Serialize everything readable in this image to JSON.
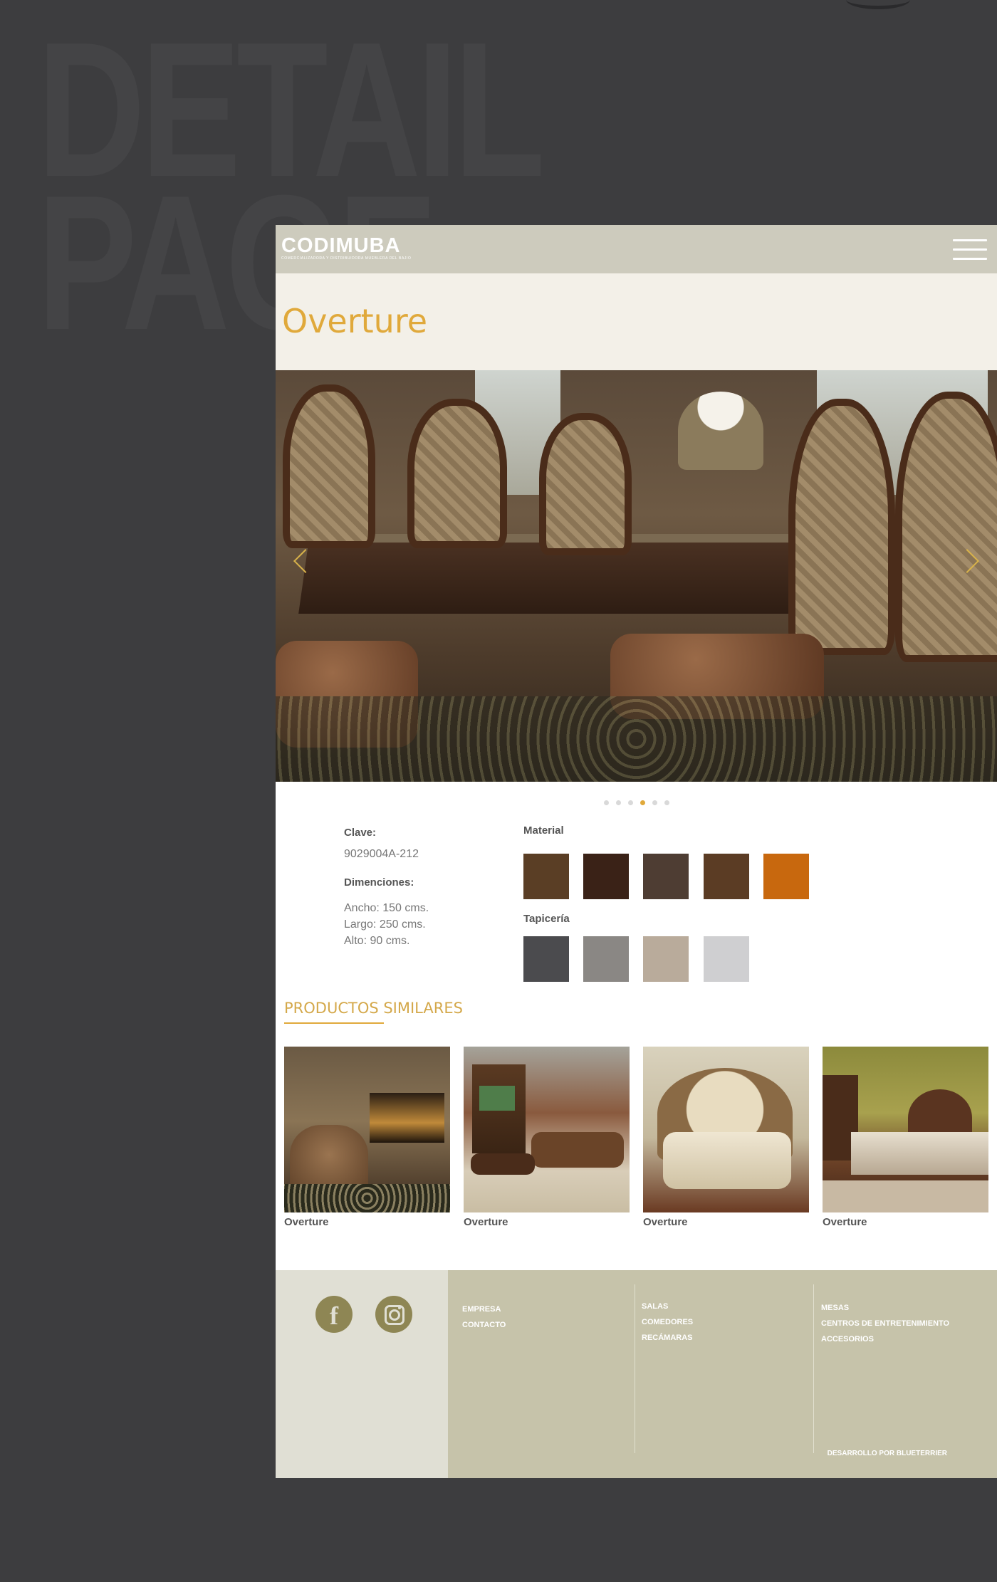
{
  "background": {
    "headline_line1": "DETAIL",
    "headline_line2": "PAGE"
  },
  "header": {
    "logo_text": "CODIMUBA",
    "logo_tagline": "COMERCIALIZADORA Y DISTRIBUIDORA MUEBLERA DEL BAJIO",
    "menu_icon": "hamburger-menu-icon"
  },
  "product": {
    "title": "Overture",
    "clave_label": "Clave:",
    "clave_value": "9029004A-212",
    "dimensions_label": "Dimenciones:",
    "dimensions": [
      "Ancho: 150 cms.",
      "Largo: 250 cms.",
      "Alto: 90 cms."
    ]
  },
  "carousel": {
    "prev_icon": "chevron-left-icon",
    "next_icon": "chevron-right-icon",
    "slide_count": 6,
    "active_index": 3
  },
  "options": {
    "material_label": "Material",
    "materials": [
      {
        "color": "#5a3e25"
      },
      {
        "color": "#3a2217"
      },
      {
        "color": "#4e3d33"
      },
      {
        "color": "#5b3c24"
      },
      {
        "color": "#c8680e"
      }
    ],
    "upholstery_label": "Tapicería",
    "upholstery": [
      {
        "color": "#4b4b4e"
      },
      {
        "color": "#8a8784"
      },
      {
        "color": "#b9ab9b"
      },
      {
        "color": "#cfcfd1"
      }
    ]
  },
  "similar": {
    "title": "PRODUCTOS SIMILARES",
    "items": [
      {
        "label": "Overture"
      },
      {
        "label": "Overture"
      },
      {
        "label": "Overture"
      },
      {
        "label": "Overture"
      }
    ]
  },
  "footer": {
    "social": {
      "facebook_icon": "facebook-icon",
      "instagram_icon": "instagram-icon"
    },
    "col1": [
      "EMPRESA",
      "CONTACTO"
    ],
    "col2": [
      "SALAS",
      "COMEDORES",
      "RECÁMARAS"
    ],
    "col3": [
      "MESAS",
      "CENTROS DE ENTRETENIMIENTO",
      "ACCESORIOS"
    ],
    "credit": "DESARROLLO POR BLUETERRIER"
  },
  "colors": {
    "accent": "#e0a93b",
    "page_background": "#3d3d3f",
    "header_bar": "#cdcbbd",
    "title_band": "#f3f0e8",
    "footer_light": "#e0dfd4",
    "footer_dark": "#c6c3aa",
    "social_icon": "#8e8654"
  }
}
